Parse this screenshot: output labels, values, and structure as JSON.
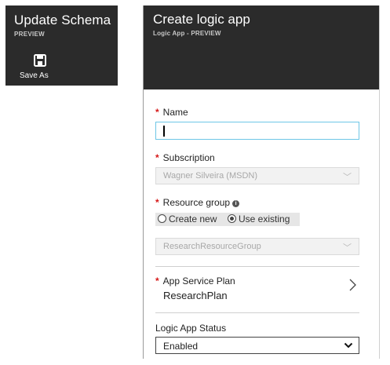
{
  "update_schema": {
    "title": "Update Schema",
    "subtitle": "PREVIEW",
    "toolbar": {
      "save_as_label": "Save As",
      "save_as_icon": "floppy-disk-icon"
    }
  },
  "create_logic_app": {
    "title": "Create logic app",
    "subtitle": "Logic App - PREVIEW",
    "required_marker": "*",
    "name": {
      "label": "Name",
      "value": ""
    },
    "subscription": {
      "label": "Subscription",
      "value": "Wagner Silveira (MSDN)"
    },
    "resource_group": {
      "label": "Resource group",
      "info_icon": "info-icon",
      "options": [
        "Create new",
        "Use existing"
      ],
      "selected": "Use existing",
      "value": "ResearchResourceGroup"
    },
    "app_service_plan": {
      "label": "App Service Plan",
      "value": "ResearchPlan"
    },
    "logic_app_status": {
      "label": "Logic App Status",
      "value": "Enabled"
    }
  },
  "colors": {
    "header_bg": "#2b2b2b",
    "required": "#d61818",
    "focus_border": "#6ec6e6"
  }
}
